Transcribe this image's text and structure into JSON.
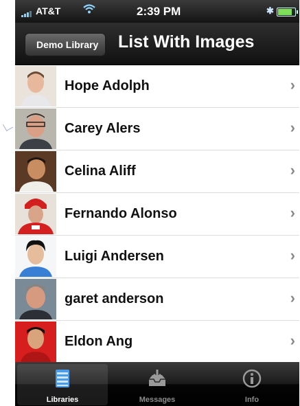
{
  "status_bar": {
    "carrier": "AT&T",
    "time": "2:39 PM",
    "bluetooth": "✱",
    "wifi_icon": "wifi-icon"
  },
  "nav_bar": {
    "back_label": "Demo Library",
    "title": "List With Images"
  },
  "list": {
    "chevron": "›",
    "items": [
      {
        "label": "Hope Adolph"
      },
      {
        "label": "Carey Alers"
      },
      {
        "label": "Celina Aliff"
      },
      {
        "label": "Fernando Alonso"
      },
      {
        "label": "Luigi Andersen"
      },
      {
        "label": "garet anderson"
      },
      {
        "label": "Eldon Ang"
      }
    ]
  },
  "tab_bar": {
    "tabs": [
      {
        "label": "Libraries",
        "icon": "libraries-icon",
        "selected": true
      },
      {
        "label": "Messages",
        "icon": "inbox-icon",
        "selected": false
      },
      {
        "label": "Info",
        "icon": "info-icon",
        "selected": false
      }
    ]
  }
}
